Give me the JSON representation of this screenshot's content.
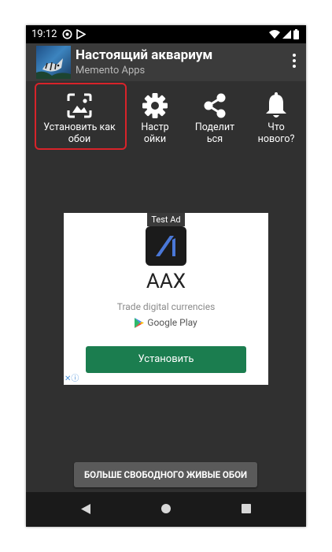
{
  "status_bar": {
    "time": "19:12",
    "icons": [
      "notification-icon",
      "play-store-icon",
      "wifi-icon",
      "signal-icon",
      "battery-icon"
    ]
  },
  "app_bar": {
    "title": "Настоящий аквариум",
    "subtitle": "Memento Apps",
    "menu_icon": "more-vert-icon"
  },
  "actions": [
    {
      "label": "Установить как обои",
      "icon": "wallpaper-icon"
    },
    {
      "label": "Настройки",
      "icon": "gear-icon"
    },
    {
      "label": "Поделиться",
      "icon": "share-icon"
    },
    {
      "label": "Что нового?",
      "icon": "bell-icon"
    }
  ],
  "ad": {
    "badge": "Test Ad",
    "name": "AAX",
    "tagline": "Trade digital currencies",
    "store": "Google Play",
    "install_label": "Установить",
    "install_color": "#1b7d4f"
  },
  "more_button_label": "БОЛЬШЕ СВОБОДНОГО ЖИВЫЕ ОБОИ",
  "nav": {
    "icons": [
      "back-icon",
      "home-icon",
      "recents-icon"
    ]
  },
  "highlight_color": "#d8232a"
}
